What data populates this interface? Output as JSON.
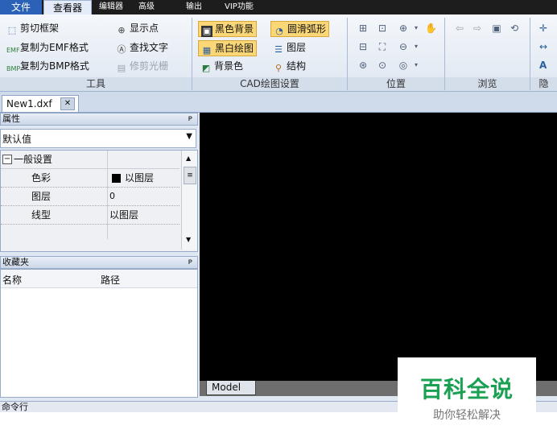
{
  "menubar": {
    "tabs": [
      {
        "label": "文件"
      },
      {
        "label": "查看器"
      },
      {
        "label": "编辑器"
      },
      {
        "label": "高级"
      },
      {
        "label": "输出"
      },
      {
        "label": "VIP功能"
      }
    ]
  },
  "ribbon": {
    "tools": {
      "items": [
        {
          "label": "剪切框架",
          "icon": "crop-frame-icon"
        },
        {
          "label": "复制为EMF格式",
          "icon": "emf-icon"
        },
        {
          "label": "复制为BMP格式",
          "icon": "bmp-icon"
        },
        {
          "label": "显示点",
          "icon": "show-points-icon"
        },
        {
          "label": "查找文字",
          "icon": "find-text-icon"
        },
        {
          "label": "修剪光栅",
          "icon": "trim-raster-icon",
          "disabled": true
        }
      ],
      "group_label": "工具"
    },
    "cad_settings": {
      "items": [
        {
          "label": "黑色背景",
          "highlighted": true
        },
        {
          "label": "黑白绘图",
          "highlighted": true
        },
        {
          "label": "背景色"
        },
        {
          "label": "圆滑弧形",
          "highlighted": true
        },
        {
          "label": "图层"
        },
        {
          "label": "结构"
        }
      ],
      "group_label": "CAD绘图设置"
    },
    "position": {
      "group_label": "位置"
    },
    "browse": {
      "group_label": "浏览"
    },
    "right_partial": {
      "items": [
        "A"
      ],
      "group_label": "隐"
    }
  },
  "doc_tabs": {
    "active": "New1.dxf"
  },
  "properties": {
    "title": "属性",
    "pin": "ᴘ",
    "dropdown_value": "默认值",
    "section": "一般设置",
    "collapse": "−",
    "rows": [
      {
        "name": "色彩",
        "value": "以图层",
        "swatch": "#000000"
      },
      {
        "name": "图层",
        "value": "0"
      },
      {
        "name": "线型",
        "value": "以图层"
      }
    ]
  },
  "favorites": {
    "title": "收藏夹",
    "pin": "ᴘ",
    "columns": [
      "名称",
      "路径"
    ]
  },
  "canvas": {
    "model_tab": "Model"
  },
  "command_line": {
    "title": "命令行"
  },
  "watermark": {
    "title": "百科全说",
    "subtitle": "助你轻松解决"
  }
}
